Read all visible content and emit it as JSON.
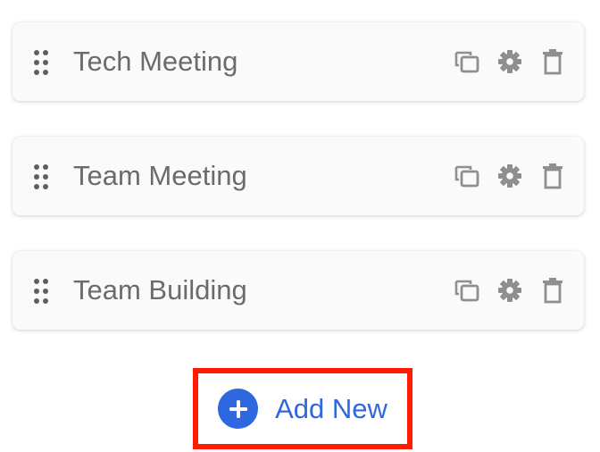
{
  "items": [
    {
      "label": "Tech Meeting"
    },
    {
      "label": "Team Meeting"
    },
    {
      "label": "Team Building"
    }
  ],
  "add_button": {
    "label": "Add New"
  },
  "colors": {
    "accent": "#2f67e0",
    "highlight_border": "#ff1a00",
    "item_text": "#6b6b6b",
    "icon": "#8f8f8f"
  },
  "icons": {
    "drag": "drag-handle-icon",
    "duplicate": "duplicate-icon",
    "settings": "gear-icon",
    "delete": "trash-icon",
    "add": "plus-icon"
  }
}
